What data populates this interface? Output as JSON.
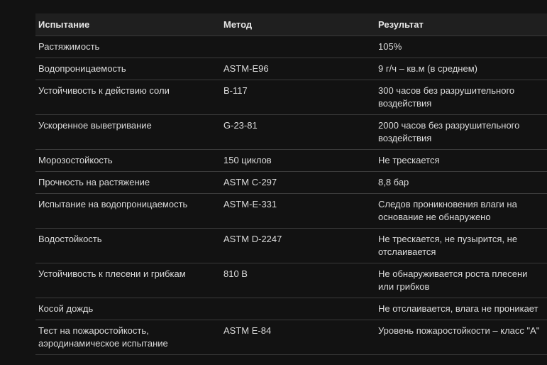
{
  "table": {
    "headers": [
      "Испытание",
      "Метод",
      "Результат"
    ],
    "rows": [
      [
        "Растяжимость",
        "",
        "105%"
      ],
      [
        "Водопроницаемость",
        "ASTM-E96",
        "9 г/ч – кв.м (в среднем)"
      ],
      [
        "Устойчивость к действию соли",
        "B-117",
        "300 часов без разрушительного воздействия"
      ],
      [
        "Ускоренное выветривание",
        "G-23-81",
        "2000 часов без разрушительного воздействия"
      ],
      [
        "Морозостойкость",
        "150 циклов",
        "Не трескается"
      ],
      [
        "Прочность на растяжение",
        "ASTM C-297",
        "8,8 бар"
      ],
      [
        "Испытание на водопроницаемость",
        "ASTM-E-331",
        "Следов проникновения влаги на основание не обнаружено"
      ],
      [
        "Водостойкость",
        "ASTM D-2247",
        "Не трескается, не пузырится, не отслаивается"
      ],
      [
        "Устойчивость к плесени и грибкам",
        "810 B",
        "Не обнаруживается роста плесени или грибков"
      ],
      [
        "Косой дождь",
        "",
        "Не отслаивается, влага не проникает"
      ],
      [
        "Тест на пожаростойкость, аэродинамическое испытание",
        "ASTM E-84",
        "Уровень пожаростойкости – класс \"A\""
      ]
    ]
  }
}
